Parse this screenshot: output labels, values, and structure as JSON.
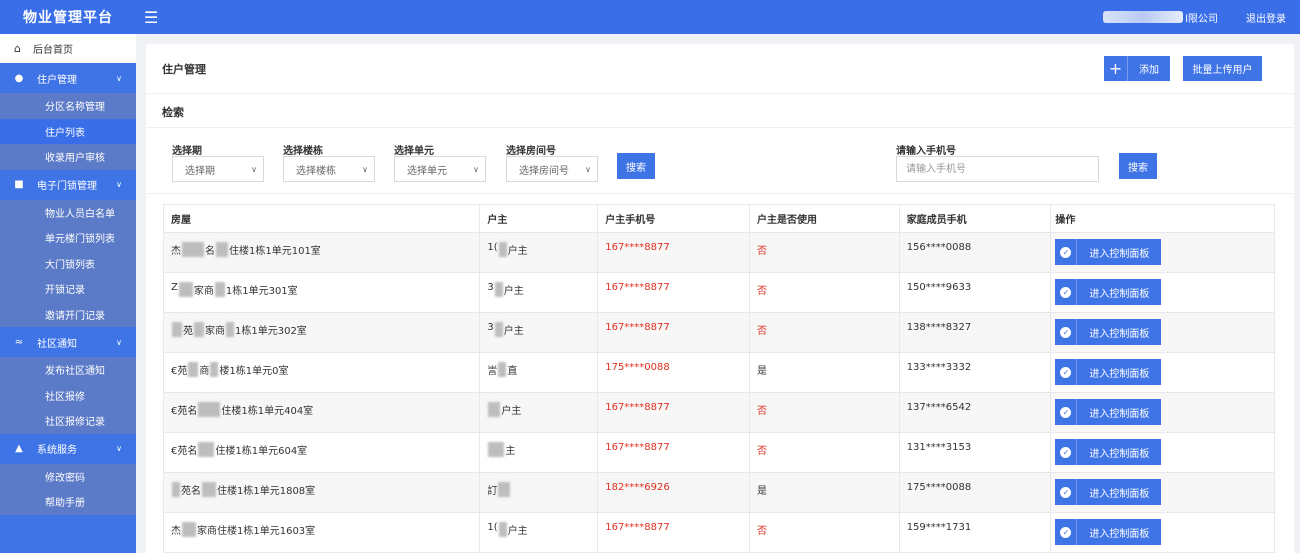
{
  "header": {
    "brand": "物业管理平台",
    "menu_icon": "hamburger-icon",
    "company_suffix": "l限公司",
    "logout": "退出登录"
  },
  "sidebar": {
    "home": {
      "label": "后台首页",
      "icon": "home-icon"
    },
    "groups": [
      {
        "label": "住户管理",
        "icon": "user-icon",
        "items": [
          "分区名称管理",
          "住户列表",
          "收录用户审核"
        ]
      },
      {
        "label": "电子门锁管理",
        "icon": "lock-icon",
        "items": [
          "物业人员白名单",
          "单元楼门锁列表",
          "大门锁列表",
          "开锁记录",
          "邀请开门记录"
        ]
      },
      {
        "label": "社区通知",
        "icon": "wifi-icon",
        "items": [
          "发布社区通知",
          "社区报修",
          "社区报修记录"
        ]
      },
      {
        "label": "系统服务",
        "icon": "user-settings-icon",
        "items": [
          "修改密码",
          "帮助手册"
        ]
      }
    ],
    "active_item": "住户列表"
  },
  "page": {
    "title": "住户管理",
    "add_label": "添加",
    "bulk_label": "批量上传用户",
    "search_title": "检索"
  },
  "filters": {
    "period_label": "选择期",
    "period_value": "选择期",
    "building_label": "选择楼栋",
    "building_value": "选择楼栋",
    "unit_label": "选择单元",
    "unit_value": "选择单元",
    "room_label": "选择房间号",
    "room_value": "选择房间号",
    "search_label": "搜索",
    "phone_label": "请输入手机号",
    "phone_placeholder": "请输入手机号",
    "phone_search_label": "搜索"
  },
  "table": {
    "columns": [
      "房屋",
      "户主",
      "户主手机号",
      "户主是否使用",
      "家庭成员手机",
      "操作"
    ],
    "action_label": "进入控制面板",
    "rows": [
      {
        "house_a": "杰",
        "house_b": "名",
        "house_c": "住楼1栋1单元101室",
        "owner_a": "1(",
        "owner_b": "户主",
        "phone": "167****8877",
        "used": "否",
        "member": "156****0088"
      },
      {
        "house_a": "Z",
        "house_b": "家商",
        "house_c": "1栋1单元301室",
        "owner_a": "3",
        "owner_b": "户主",
        "phone": "167****8877",
        "used": "否",
        "member": "150****9633"
      },
      {
        "house_a": "",
        "house_b": "苑",
        "house_c": "家商",
        "owner_a": "3",
        "owner_b": "户主",
        "phone": "167****8877",
        "used": "否",
        "member": "138****8327"
      },
      {
        "house_a": "€苑",
        "house_b": "商",
        "house_c": "楼1栋1单元0室",
        "owner_a": "訔",
        "owner_b": "直",
        "phone": "175****0088",
        "used": "是",
        "member": "133****3332"
      },
      {
        "house_a": "€苑名",
        "house_b": "",
        "house_c": "住楼1栋1单元404室",
        "owner_a": "",
        "owner_b": "户主",
        "phone": "167****8877",
        "used": "否",
        "member": "137****6542"
      },
      {
        "house_a": "€苑名",
        "house_b": "",
        "house_c": "住楼1栋1单元604室",
        "owner_a": "",
        "owner_b": "主",
        "phone": "167****8877",
        "used": "否",
        "member": "131****3153"
      },
      {
        "house_a": "",
        "house_b": "苑名",
        "house_c": "住楼1栋1单元1808室",
        "owner_a": "訂",
        "owner_b": "",
        "phone": "182****6926",
        "used": "是",
        "member": "175****0088"
      },
      {
        "house_a": "杰",
        "house_b": "",
        "house_c": "家商住楼1栋1单元1603室",
        "owner_a": "1(",
        "owner_b": "户主",
        "phone": "167****8877",
        "used": "否",
        "member": "159****1731"
      }
    ]
  }
}
